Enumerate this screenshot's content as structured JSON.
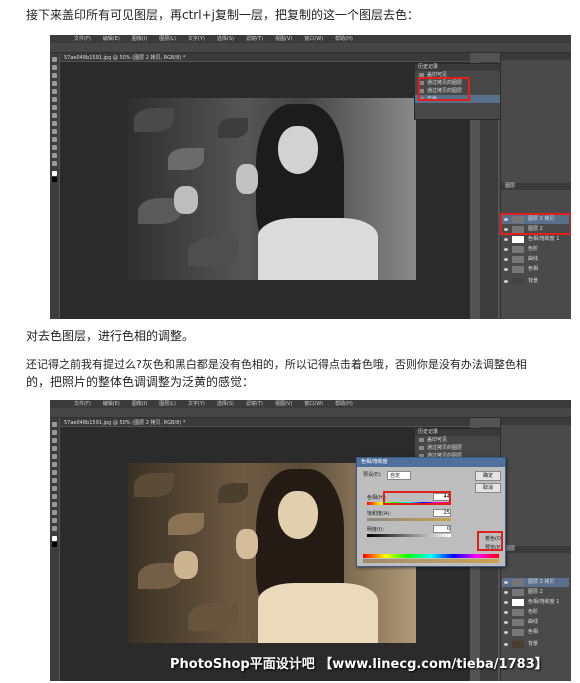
{
  "text": {
    "p1": "接下来盖印所有可见图层，再ctrl+j复制一层，把复制的这一个图层去色：",
    "p2": "对去色图层，进行色相的调整。",
    "p3a": "还记得之前我有提过么?灰色和黑白都是没有色相的，所以记得点击着色哦，否则你是没有办法调整色相",
    "p3b": "的，把照片的整体色调调整为泛黄的感觉："
  },
  "menu": [
    "文件(F)",
    "编辑(E)",
    "图像(I)",
    "图层(L)",
    "文字(Y)",
    "选择(S)",
    "滤镜(T)",
    "视图(V)",
    "窗口(W)",
    "帮助(H)"
  ],
  "screenshot1": {
    "tab": "57ae048b1591.jpg @ 50% (图层 2 拷贝, RGB/8) *",
    "history_title": "历史记录",
    "history": [
      "盖印可见",
      "通过拷贝的图层",
      "通过拷贝的图层",
      "去色"
    ],
    "layers_title": "图层",
    "layers": [
      "图层 2 拷贝",
      "图层 2",
      "色相/饱和度 1",
      "色阶",
      "曲线",
      "色相",
      "背景"
    ],
    "opacity": "100%"
  },
  "screenshot2": {
    "tab": "57ae048b1591.jpg @ 50% (图层 2 拷贝, RGB/8) *",
    "dialog_title": "色相/饱和度",
    "preset_label": "预设(E):",
    "preset_value": "自定",
    "hue_label": "色相(H):",
    "hue_value": "44",
    "sat_label": "饱和度(A):",
    "sat_value": "25",
    "light_label": "明度(I):",
    "light_value": "0",
    "ok": "确定",
    "cancel": "取消",
    "colorize": "着色(O)",
    "preview": "预览(P)",
    "watermark": "PhotoShop平面设计吧 【www.linecg.com/tieba/1783】"
  },
  "colors": {
    "highlight": "#e0201a",
    "sepia": "#a08867"
  }
}
